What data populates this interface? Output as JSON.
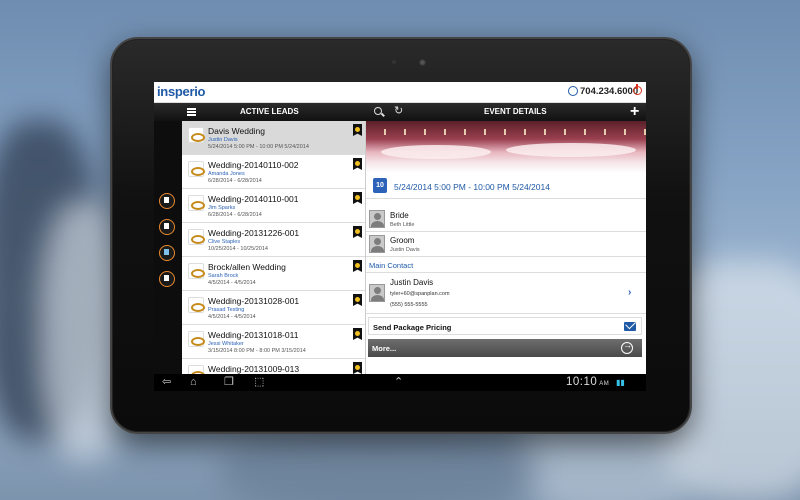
{
  "header": {
    "logo_text": "insperio",
    "phone": "704.234.6000"
  },
  "toolbar": {
    "leads_title": "ACTIVE LEADS",
    "event_title": "EVENT DETAILS"
  },
  "leads": [
    {
      "name": "Davis Wedding",
      "person": "Justin Davis",
      "dates": "5/24/2014  5:00 PM - 10:00 PM 5/24/2014",
      "selected": true
    },
    {
      "name": "Wedding-20140110-002",
      "person": "Amanda Jones",
      "dates": "6/28/2014  -  6/28/2014"
    },
    {
      "name": "Wedding-20140110-001",
      "person": "Jim Sparks",
      "dates": "6/28/2014  -  6/28/2014"
    },
    {
      "name": "Wedding-20131226-001",
      "person": "Clive Staples",
      "dates": "10/25/2014  -  10/25/2014"
    },
    {
      "name": "Brock/allen Wedding",
      "person": "Sarah Brock",
      "dates": "4/5/2014  -  4/5/2014"
    },
    {
      "name": "Wedding-20131028-001",
      "person": "Prasad Testing",
      "dates": "4/5/2014  -  4/5/2014"
    },
    {
      "name": "Wedding-20131018-011",
      "person": "Jessi Whitaker",
      "dates": "3/15/2014  8:00 PM - 8:00 PM 3/15/2014"
    },
    {
      "name": "Wedding-20131009-013",
      "person": "",
      "dates": ""
    }
  ],
  "details": {
    "calendar_day": "10",
    "date_range": "5/24/2014  5:00 PM - 10:00 PM 5/24/2014",
    "bride_label": "Bride",
    "bride_name": "Beth Little",
    "groom_label": "Groom",
    "groom_name": "Justin Davis",
    "main_contact_title": "Main Contact",
    "contact_name": "Justin Davis",
    "contact_email": "tyler+60@spanplan.com",
    "contact_phone": "(555) 555-5555",
    "package_label": "Send Package Pricing",
    "more_label": "More..."
  },
  "system_bar": {
    "time": "10:10",
    "ampm": "AM"
  },
  "colors": {
    "accent_blue": "#1f5aa6",
    "rail_ring": "#e8892c",
    "power_red": "#d8321e"
  }
}
